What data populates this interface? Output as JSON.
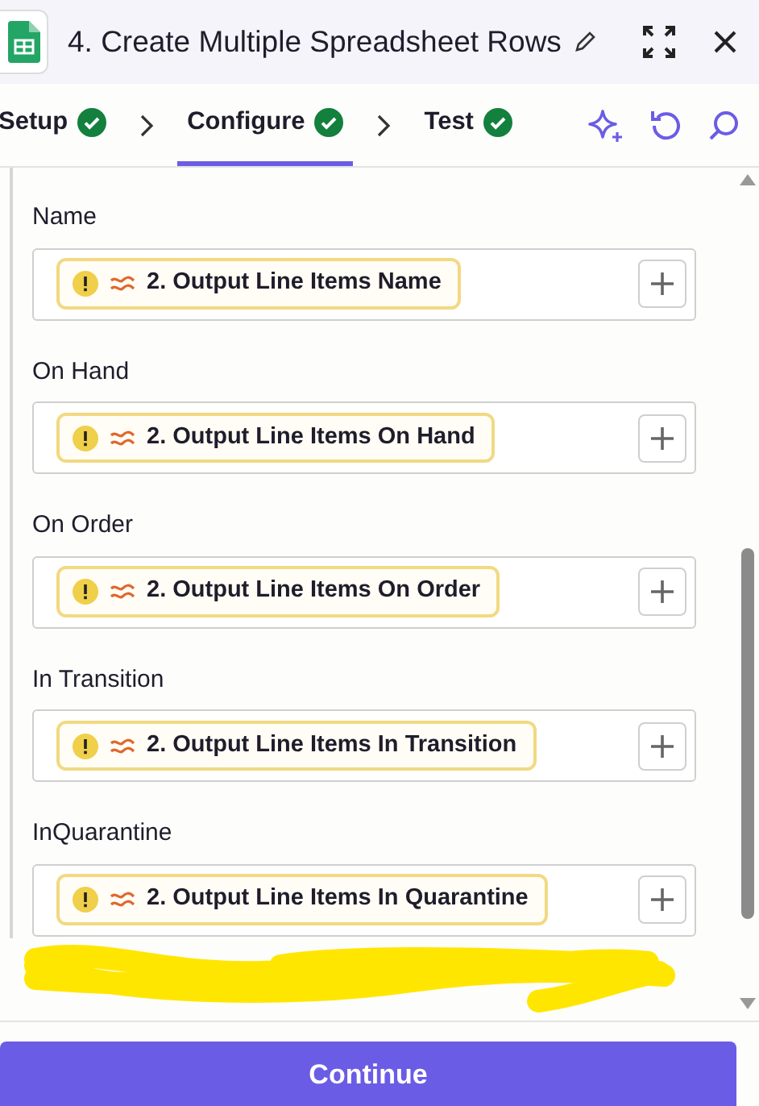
{
  "header": {
    "title": "4. Create Multiple Spreadsheet Rows"
  },
  "steps": [
    {
      "label": "Setup",
      "selected": false,
      "complete": true
    },
    {
      "label": "Configure",
      "selected": true,
      "complete": true
    },
    {
      "label": "Test",
      "selected": false,
      "complete": true
    }
  ],
  "fields": [
    {
      "label": "Name",
      "value": "2. Output Line Items Name",
      "warning": true
    },
    {
      "label": "On Hand",
      "value": "2. Output Line Items On Hand",
      "warning": true
    },
    {
      "label": "On Order",
      "value": "2. Output Line Items On Order",
      "warning": true
    },
    {
      "label": "In Transition",
      "value": "2. Output Line Items In Transition",
      "warning": true
    },
    {
      "label": "InQuarantine",
      "value": "2. Output Line Items In Quarantine",
      "warning": true
    }
  ],
  "continue_button": "Continue"
}
